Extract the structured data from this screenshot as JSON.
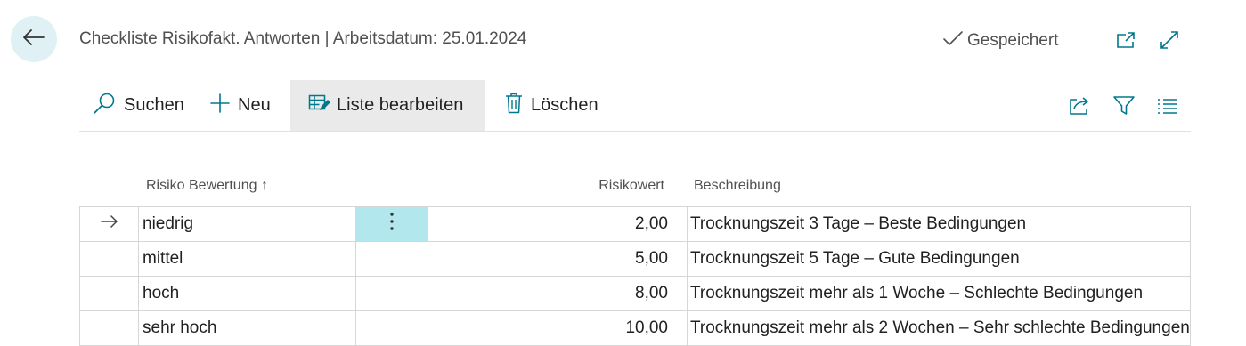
{
  "header": {
    "title": "Checkliste Risikofakt. Antworten | Arbeitsdatum: 25.01.2024",
    "status": "Gespeichert"
  },
  "toolbar": {
    "search_label": "Suchen",
    "new_label": "Neu",
    "edit_list_label": "Liste bearbeiten",
    "delete_label": "Löschen"
  },
  "columns": {
    "risk": "Risiko Bewertung ↑",
    "value": "Risikowert",
    "description": "Beschreibung"
  },
  "rows": [
    {
      "risk": "niedrig",
      "value": "2,00",
      "description": "Trocknungszeit 3 Tage – Beste Bedingungen"
    },
    {
      "risk": "mittel",
      "value": "5,00",
      "description": "Trocknungszeit 5 Tage – Gute Bedingungen"
    },
    {
      "risk": "hoch",
      "value": "8,00",
      "description": "Trocknungszeit mehr als 1 Woche – Schlechte Bedingungen"
    },
    {
      "risk": "sehr hoch",
      "value": "10,00",
      "description": "Trocknungszeit mehr als 2 Wochen – Sehr schlechte Bedingungen"
    }
  ],
  "colors": {
    "accent": "#00788c",
    "selected_cell": "#b3e7ee",
    "back_button": "#dff1f4"
  }
}
